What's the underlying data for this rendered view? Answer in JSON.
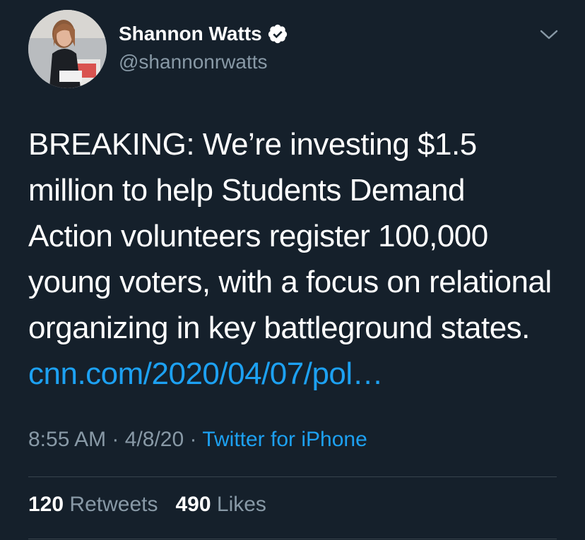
{
  "user": {
    "display_name": "Shannon Watts",
    "handle": "@shannonrwatts",
    "verified": true
  },
  "tweet": {
    "text_lines": [
      "BREAKING: We’re investing $1.5",
      "million to help Students Demand",
      "Action volunteers register 100,000",
      "young voters, with a focus on relational",
      "organizing in key battleground states."
    ],
    "link": "cnn.com/2020/04/07/pol…"
  },
  "meta": {
    "time": "8:55 AM",
    "separator": "·",
    "date": "4/8/20",
    "source": "Twitter for iPhone"
  },
  "stats": {
    "retweets_count": "120",
    "retweets_label": "Retweets",
    "likes_count": "490",
    "likes_label": "Likes"
  },
  "icons": {
    "verified": "verified-badge-icon",
    "more": "chevron-down-icon"
  },
  "colors": {
    "background": "#15202b",
    "accent": "#1da1f2",
    "secondary_text": "#8899a6",
    "divider": "#38444d"
  }
}
